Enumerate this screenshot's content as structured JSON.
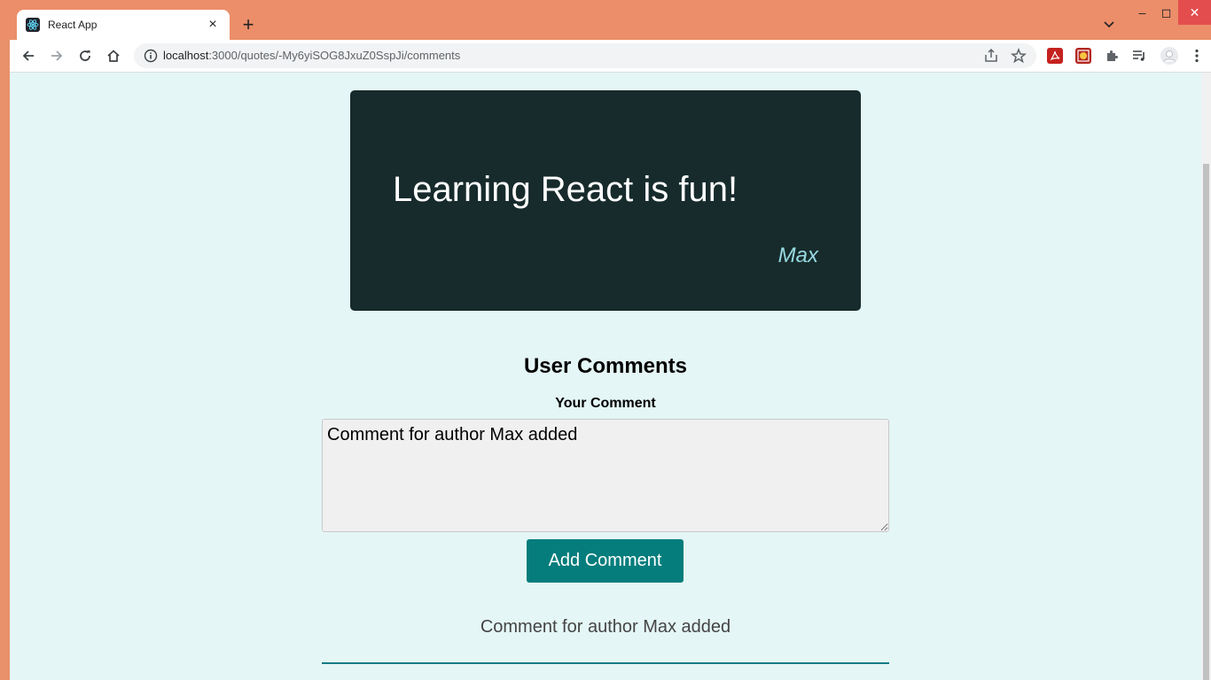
{
  "browser": {
    "tab_title": "React App",
    "tab_close": "×",
    "new_tab": "+",
    "url_host": "localhost",
    "url_rest": ":3000/quotes/-My6yiSOG8JxuZ0SspJi/comments",
    "minimize": "–",
    "maximize": "◻",
    "close": "✕"
  },
  "quote": {
    "text": "Learning React is fun!",
    "author": "Max"
  },
  "comments": {
    "heading": "User Comments",
    "label": "Your Comment",
    "textarea_value": "Comment for author Max added",
    "button_label": "Add Comment",
    "items": [
      "Comment for author Max added"
    ]
  },
  "colors": {
    "titlebar": "#eb8e69",
    "page_bg": "#e4f6f5",
    "quote_bg": "#172b2c",
    "author": "#97dbe2",
    "button": "#047d7c"
  }
}
